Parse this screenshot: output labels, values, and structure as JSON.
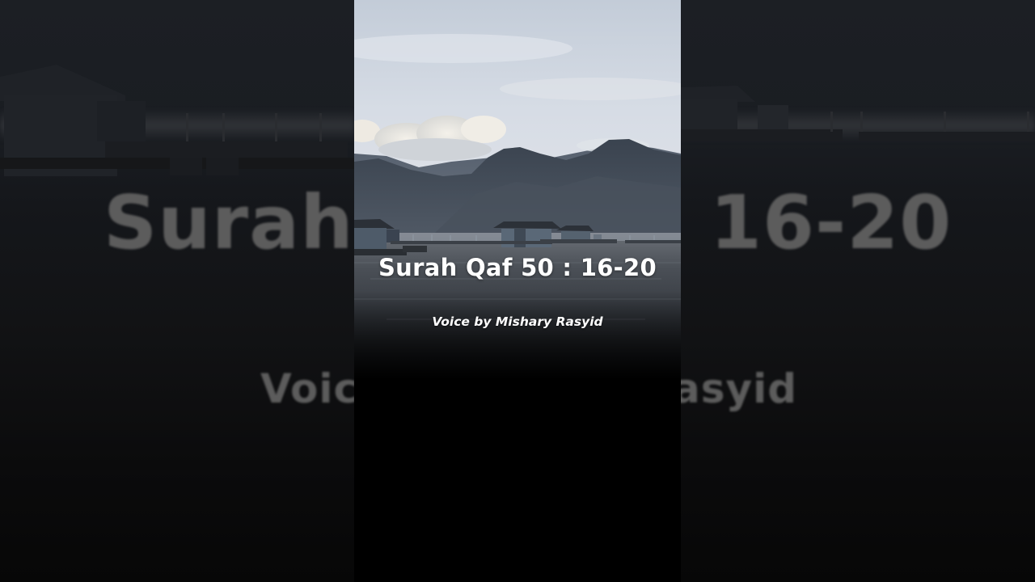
{
  "video": {
    "title": "Surah Qaf 50 : 16-20",
    "subtitle": "Voice by Mishary Rasyid"
  },
  "background": {
    "left_title_fragment": "Surah",
    "right_title_fragment": "16-20",
    "left_subtitle_fragment": "Voic",
    "right_subtitle_fragment": "asyid"
  },
  "colors": {
    "sky_top": "#c9d3e0",
    "mountains": "#3d4651",
    "water": "#3a4048",
    "text": "#ffffff"
  }
}
